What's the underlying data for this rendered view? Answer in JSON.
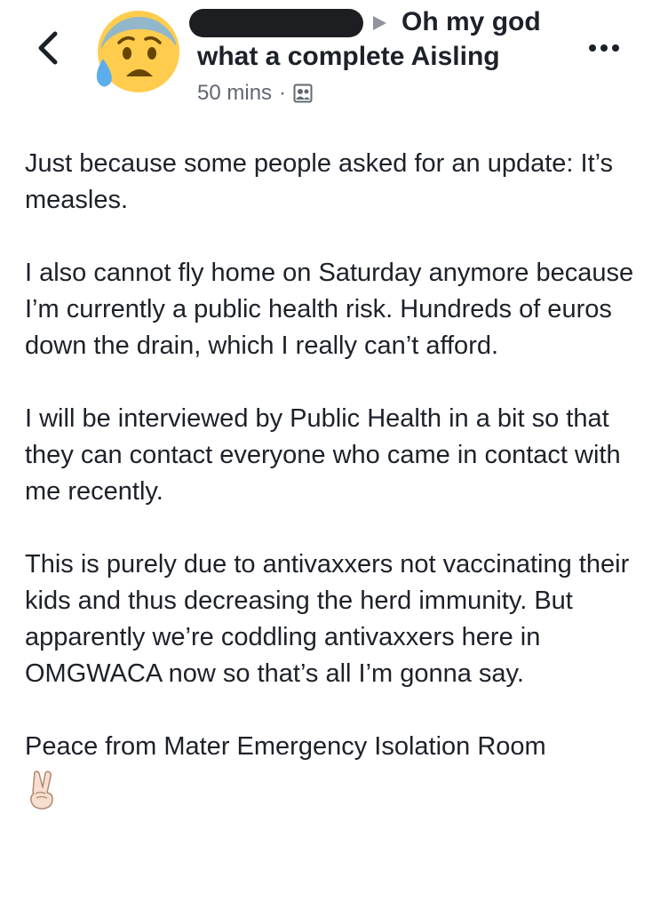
{
  "header": {
    "back_icon": "chevron-left-icon",
    "avatar_icon": "anxious-face-with-sweat-emoji",
    "arrow_icon": "triangle-right-icon",
    "group_name_line1": "Oh my god",
    "group_name_line2": "what a complete Aisling",
    "timestamp": "50 mins",
    "separator": "·",
    "audience_icon": "members-icon",
    "more_icon": "more-dots-icon"
  },
  "post": {
    "paragraphs": [
      "Just because some people asked for an update: It’s measles.",
      "I also cannot fly home on Saturday anymore because I’m currently a public health risk. Hundreds of euros down the drain, which I really can’t afford.",
      "I will be interviewed by Public Health in a bit so that they can contact everyone who came in contact with me recently.",
      "This is purely due to antivaxxers not vaccinating their kids and thus decreasing the herd immunity. But apparently we’re coddling antivaxxers here in OMGWACA now so that’s all I’m gonna say.",
      "Peace from Mater Emergency Isolation Room"
    ],
    "closing_emoji": "victory-hand-emoji"
  },
  "colors": {
    "text": "#1d2129",
    "meta_text": "#616770",
    "avatar_face": "#ffcc4d",
    "avatar_sweat": "#5dadec"
  }
}
